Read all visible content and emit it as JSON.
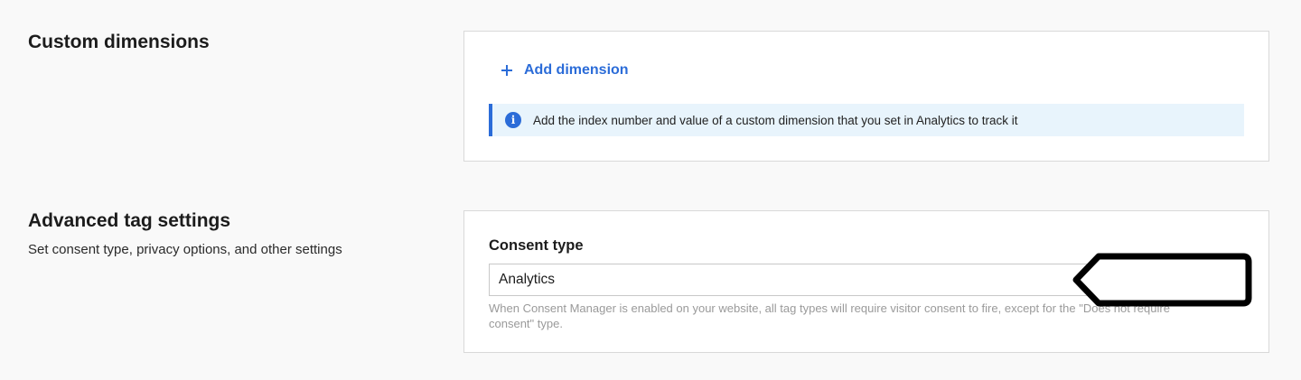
{
  "custom_dimensions": {
    "title": "Custom dimensions",
    "add_label": "Add dimension",
    "info_text": "Add the index number and value of a custom dimension that you set in Analytics to track it",
    "info_icon": "info-icon"
  },
  "advanced_tag_settings": {
    "title": "Advanced tag settings",
    "subtitle": "Set consent type, privacy options, and other settings",
    "consent_type": {
      "label": "Consent type",
      "value": "Analytics",
      "help": "When Consent Manager is enabled on your website, all tag types will require visitor consent to fire, except for the \"Does not require consent\" type."
    }
  },
  "colors": {
    "accent": "#2b6cd8",
    "info_bg": "#e8f4fc",
    "page_bg": "#f9f9f9"
  }
}
